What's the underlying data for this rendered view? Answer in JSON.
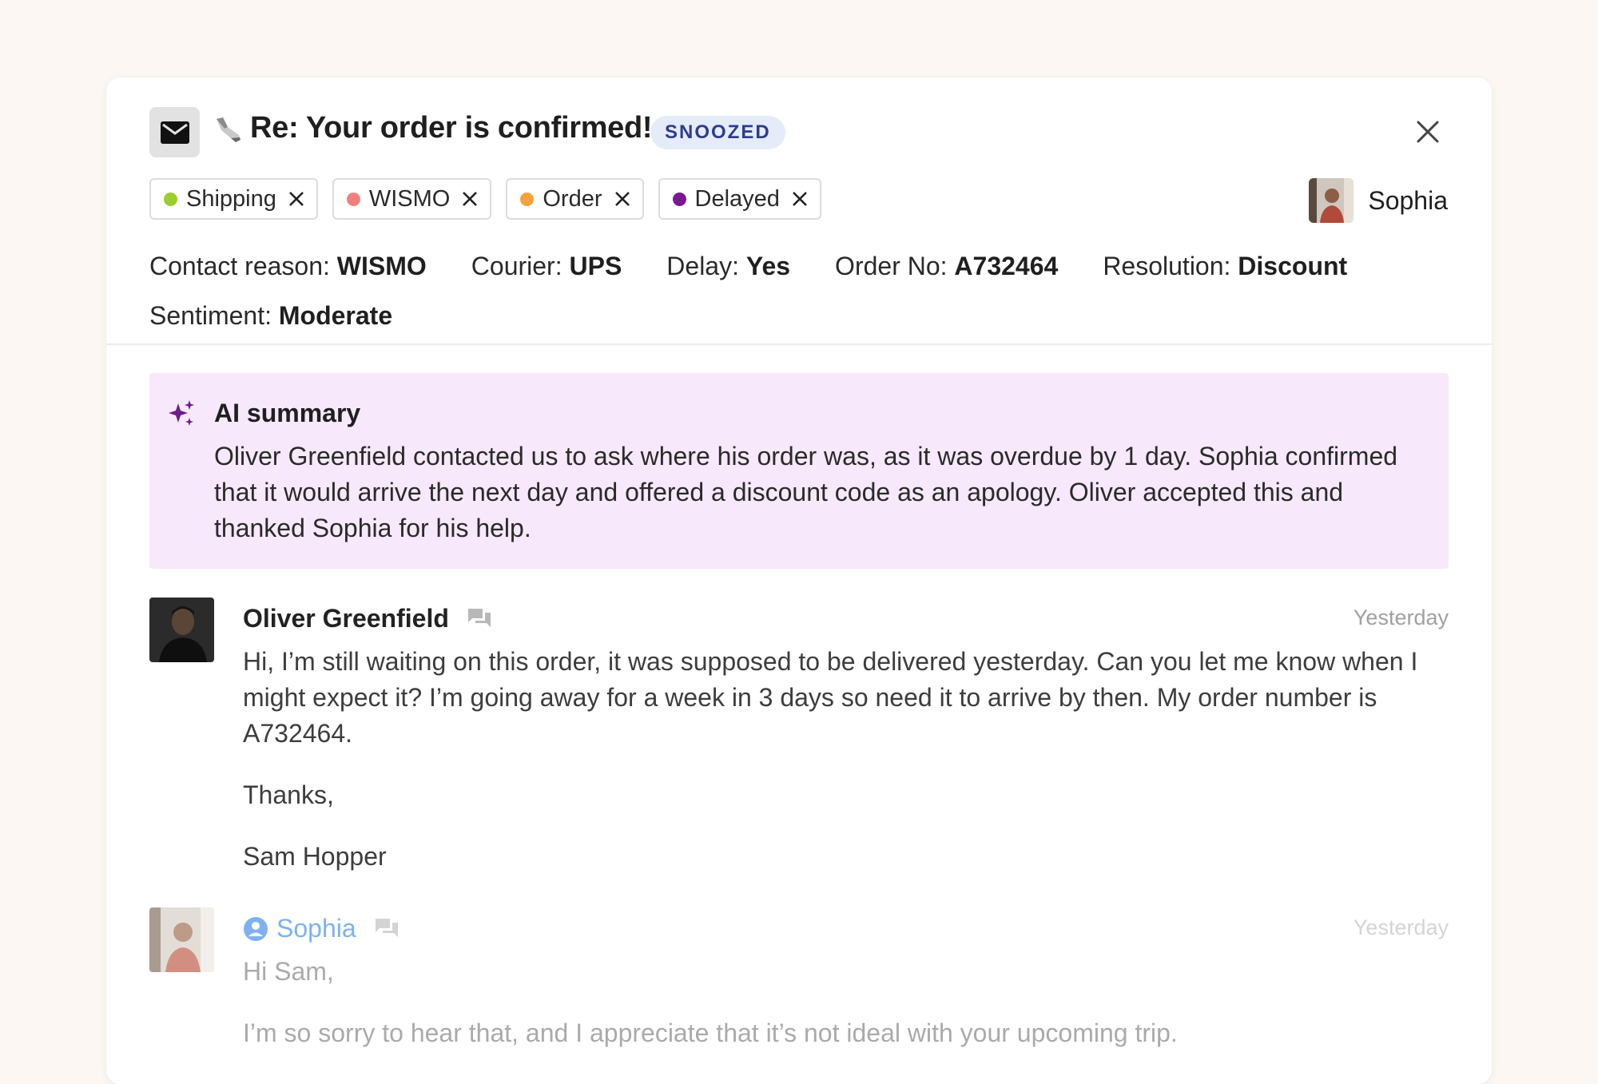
{
  "ticket": {
    "title": "Re: Your order is confirmed!",
    "status": "SNOOZED",
    "tags": [
      {
        "label": "Shipping",
        "color": "#9ccc2e"
      },
      {
        "label": "WISMO",
        "color": "#f08080"
      },
      {
        "label": "Order",
        "color": "#f5a23a"
      },
      {
        "label": "Delayed",
        "color": "#7a1a93"
      }
    ],
    "assignee": "Sophia",
    "fields": {
      "contact_reason_label": "Contact reason:",
      "contact_reason_value": "WISMO",
      "courier_label": "Courier:",
      "courier_value": "UPS",
      "delay_label": "Delay:",
      "delay_value": "Yes",
      "order_label": "Order No:",
      "order_value": "A732464",
      "resolution_label": "Resolution:",
      "resolution_value": "Discount",
      "sentiment_label": "Sentiment:",
      "sentiment_value": "Moderate"
    }
  },
  "ai_summary": {
    "heading": "AI summary",
    "text": "Oliver Greenfield contacted us to ask where his order was, as it was overdue by 1 day. Sophia confirmed that it would arrive the next day and offered a discount code as an apology. Oliver accepted this and thanked Sophia for his help."
  },
  "messages": [
    {
      "sender": "Oliver Greenfield",
      "time": "Yesterday",
      "paragraphs": [
        "Hi, I’m still waiting on this order, it was supposed to be delivered yesterday. Can you let me know when I might expect it? I’m going away for a week in 3 days so need it to arrive by then. My order number is A732464.",
        "Thanks,",
        "Sam Hopper"
      ]
    },
    {
      "sender": "Sophia",
      "time": "Yesterday",
      "paragraphs": [
        "Hi Sam,",
        "I’m so sorry to hear that, and I appreciate that it’s not ideal with your upcoming trip."
      ]
    }
  ]
}
